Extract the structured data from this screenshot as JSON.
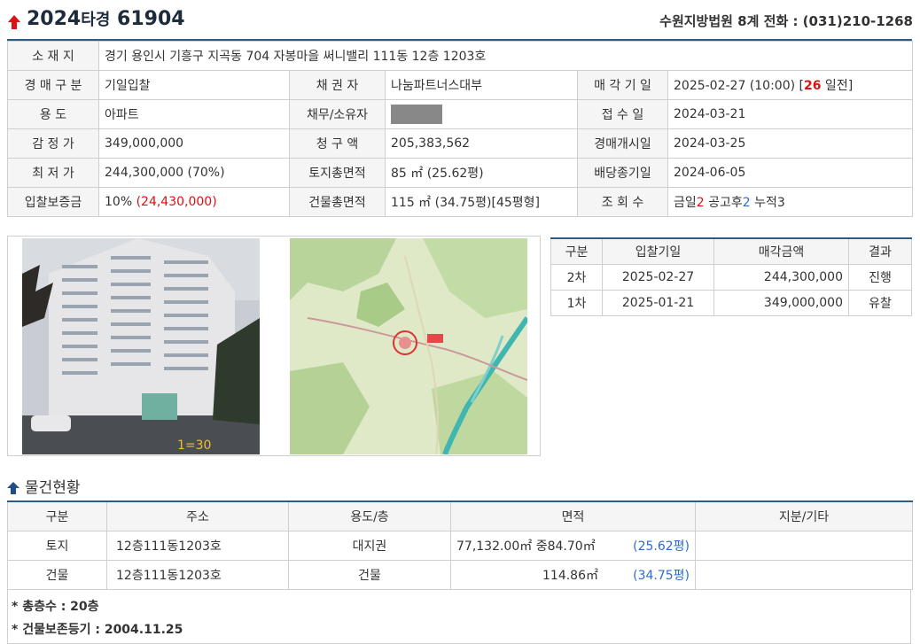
{
  "header": {
    "case_year": "2024",
    "case_type": "타경",
    "case_num": "61904",
    "court_info": "수원지방법원 8계 전화 : (031)210-1268"
  },
  "info": {
    "location_label": "소 재 지",
    "location": "경기 용인시 기흥구 지곡동 704 자봉마을 써니밸리 111동 12층 1203호",
    "auction_type_label": "경 매 구 분",
    "auction_type": "기일입찰",
    "creditor_label": "채 권 자",
    "creditor": "나눔파트너스대부",
    "sale_date_label": "매 각 기 일",
    "sale_date": "2025-02-27 (10:00) [",
    "sale_days": "26",
    "sale_days_suffix": " 일전]",
    "use_label": "용 도",
    "use": "아파트",
    "debtor_label": "채무/소유자",
    "receipt_label": "접 수 일",
    "receipt": "2024-03-21",
    "appraisal_label": "감 정 가",
    "appraisal": "349,000,000",
    "claim_label": "청 구 액",
    "claim": "205,383,562",
    "start_label": "경매개시일",
    "start": "2024-03-25",
    "min_label": "최 저 가",
    "min_price": "244,300,000 (70%)",
    "land_area_label": "토지총면적",
    "land_area": "85 ㎡ (25.62평)",
    "dividend_label": "배당종기일",
    "dividend": "2024-06-05",
    "deposit_label": "입찰보증금",
    "deposit_pct": "10% ",
    "deposit_amt": "(24,430,000)",
    "bldg_area_label": "건물총면적",
    "bldg_area": "115 ㎡ (34.75평)[45평형]",
    "views_label": "조 회 수",
    "views_today_label": "금일",
    "views_today": "2",
    "views_after_label": " 공고후",
    "views_after": "2",
    "views_total_label": " 누적",
    "views_total": "3"
  },
  "history": {
    "headers": [
      "구분",
      "입찰기일",
      "매각금액",
      "결과"
    ],
    "rows": [
      {
        "round": "2차",
        "date": "2025-02-27",
        "amount": "244,300,000",
        "result": "진행"
      },
      {
        "round": "1차",
        "date": "2025-01-21",
        "amount": "349,000,000",
        "result": "유찰"
      }
    ]
  },
  "section_title": "물건현황",
  "property": {
    "headers": [
      "구분",
      "주소",
      "용도/층",
      "면적",
      "지분/기타"
    ],
    "rows": [
      {
        "type": "토지",
        "addr": "12층111동1203호",
        "use": "대지권",
        "area": "77,132.00㎡ 중84.70㎡",
        "pyeong": "(25.62평)",
        "etc": ""
      },
      {
        "type": "건물",
        "addr": "12층111동1203호",
        "use": "건물",
        "area": "114.86㎡",
        "pyeong": "(34.75평)",
        "etc": ""
      }
    ]
  },
  "notes": [
    "* 총층수 : 20층",
    "* 건물보존등기 : 2004.11.25"
  ],
  "colors": {
    "accent": "#2f5a86",
    "red": "#dd1111",
    "blue": "#2b6cd0"
  }
}
